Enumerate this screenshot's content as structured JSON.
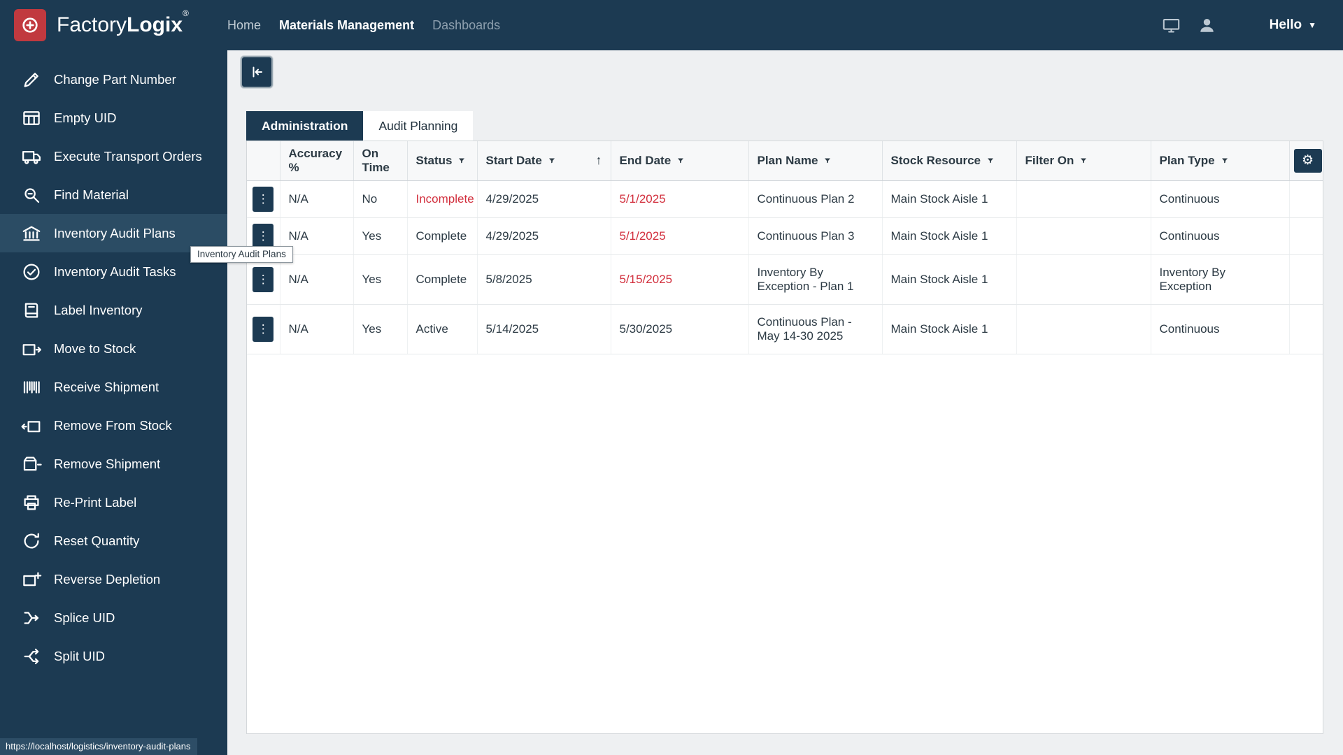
{
  "topbar": {
    "brand": {
      "name_regular": "Factory",
      "name_bold": "Logix",
      "registered": "®"
    },
    "nav": [
      {
        "label": "Home"
      },
      {
        "label": "Materials Management"
      },
      {
        "label": "Dashboards"
      }
    ],
    "user_menu": {
      "label": "Hello"
    }
  },
  "sidebar": {
    "items": [
      {
        "label": "Change Part Number",
        "icon": "pencil-icon"
      },
      {
        "label": "Empty UID",
        "icon": "grid-icon"
      },
      {
        "label": "Execute Transport Orders",
        "icon": "truck-icon"
      },
      {
        "label": "Find Material",
        "icon": "search-icon"
      },
      {
        "label": "Inventory Audit Plans",
        "icon": "bank-icon",
        "selected": true
      },
      {
        "label": "Inventory Audit Tasks",
        "icon": "check-circle-icon"
      },
      {
        "label": "Label Inventory",
        "icon": "book-icon"
      },
      {
        "label": "Move to Stock",
        "icon": "box-in-icon"
      },
      {
        "label": "Receive Shipment",
        "icon": "barcode-icon"
      },
      {
        "label": "Remove From Stock",
        "icon": "box-out-icon"
      },
      {
        "label": "Remove Shipment",
        "icon": "box-remove-icon"
      },
      {
        "label": "Re-Print Label",
        "icon": "printer-icon"
      },
      {
        "label": "Reset Quantity",
        "icon": "reset-icon"
      },
      {
        "label": "Reverse Depletion",
        "icon": "box-plus-icon"
      },
      {
        "label": "Splice UID",
        "icon": "splice-icon"
      },
      {
        "label": "Split UID",
        "icon": "split-icon"
      }
    ],
    "tooltip": "Inventory Audit Plans",
    "status_url": "https://localhost/logistics/inventory-audit-plans"
  },
  "main": {
    "tabs": [
      {
        "label": "Administration",
        "active": true
      },
      {
        "label": "Audit Planning",
        "active": false
      }
    ],
    "table": {
      "columns": [
        {
          "label": ""
        },
        {
          "label": "Accuracy %"
        },
        {
          "label": "On Time"
        },
        {
          "label": "Status",
          "filter": true
        },
        {
          "label": "Start Date",
          "filter": true,
          "sort": "asc"
        },
        {
          "label": "End Date",
          "filter": true
        },
        {
          "label": "Plan Name",
          "filter": true
        },
        {
          "label": "Stock Resource",
          "filter": true
        },
        {
          "label": "Filter On",
          "filter": true
        },
        {
          "label": "Plan Type",
          "filter": true
        },
        {
          "label": ""
        }
      ],
      "sort_glyph": "↑",
      "rows": [
        {
          "accuracy": "N/A",
          "on_time": "No",
          "status": "Incomplete",
          "status_tone": "danger",
          "start_date": "4/29/2025",
          "end_date": "5/1/2025",
          "end_tone": "danger",
          "plan_name": "Continuous Plan 2",
          "stock_resource": "Main Stock Aisle 1",
          "filter_on": "",
          "plan_type": "Continuous"
        },
        {
          "accuracy": "N/A",
          "on_time": "Yes",
          "status": "Complete",
          "status_tone": "normal",
          "start_date": "4/29/2025",
          "end_date": "5/1/2025",
          "end_tone": "danger",
          "plan_name": "Continuous Plan 3",
          "stock_resource": "Main Stock Aisle 1",
          "filter_on": "",
          "plan_type": "Continuous"
        },
        {
          "accuracy": "N/A",
          "on_time": "Yes",
          "status": "Complete",
          "status_tone": "normal",
          "start_date": "5/8/2025",
          "end_date": "5/15/2025",
          "end_tone": "danger",
          "plan_name": "Inventory By Exception - Plan 1",
          "stock_resource": "Main Stock Aisle 1",
          "filter_on": "",
          "plan_type": "Inventory By Exception"
        },
        {
          "accuracy": "N/A",
          "on_time": "Yes",
          "status": "Active",
          "status_tone": "normal",
          "start_date": "5/14/2025",
          "end_date": "5/30/2025",
          "end_tone": "normal",
          "plan_name": "Continuous Plan - May 14-30 2025",
          "stock_resource": "Main Stock Aisle 1",
          "filter_on": "",
          "plan_type": "Continuous"
        }
      ]
    }
  }
}
